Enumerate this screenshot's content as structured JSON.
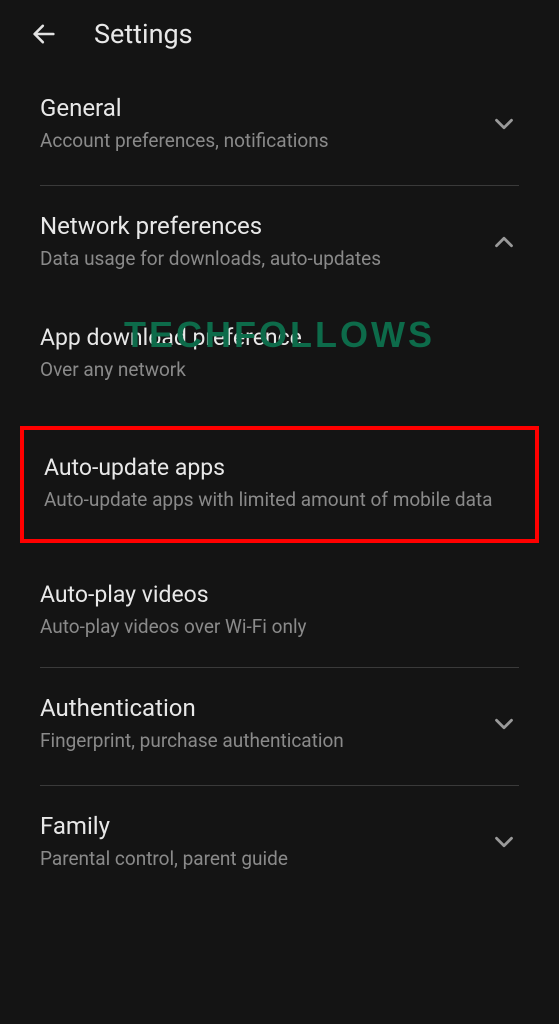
{
  "header": {
    "title": "Settings"
  },
  "sections": {
    "general": {
      "title": "General",
      "subtitle": "Account preferences, notifications"
    },
    "network": {
      "title": "Network preferences",
      "subtitle": "Data usage for downloads, auto-updates"
    },
    "appDownload": {
      "title": "App download preference",
      "subtitle": "Over any network"
    },
    "autoUpdate": {
      "title": "Auto-update apps",
      "subtitle": "Auto-update apps with limited amount of mobile data"
    },
    "autoPlay": {
      "title": "Auto-play videos",
      "subtitle": "Auto-play videos over Wi-Fi only"
    },
    "authentication": {
      "title": "Authentication",
      "subtitle": "Fingerprint, purchase authentication"
    },
    "family": {
      "title": "Family",
      "subtitle": "Parental control, parent guide"
    }
  },
  "watermark": "TECHFOLLOWS"
}
